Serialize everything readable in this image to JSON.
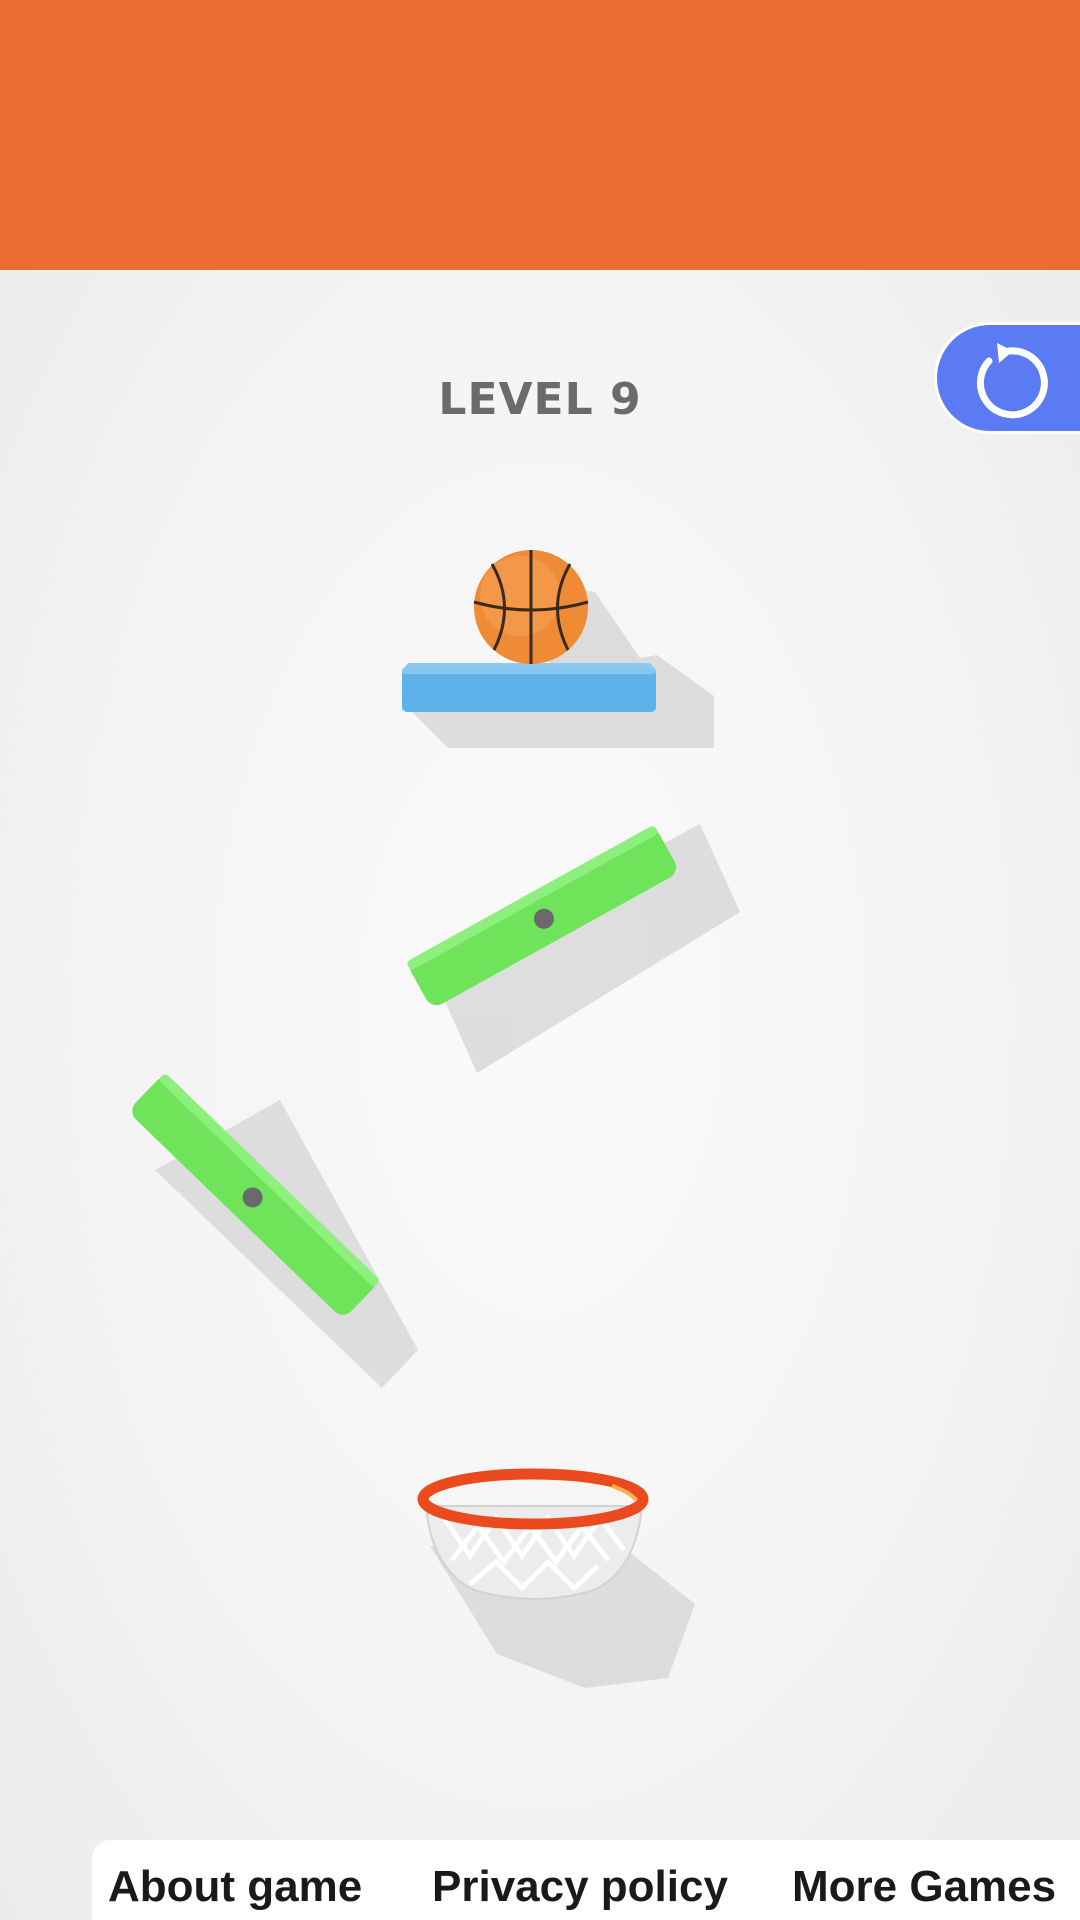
{
  "colors": {
    "top_bar": "#eb6d33",
    "restart_button": "#5b7bf5",
    "ball": "#ef8a37",
    "start_platform": "#5db2ea",
    "rotating_platform": "#6fe35a",
    "hoop_rim": "#ea4a1d",
    "pivot": "#6a6a6a"
  },
  "game": {
    "level_label": "LEVEL 9",
    "restart_icon": "restart-icon"
  },
  "footer": {
    "links": [
      "About game",
      "Privacy policy",
      "More Games"
    ]
  }
}
